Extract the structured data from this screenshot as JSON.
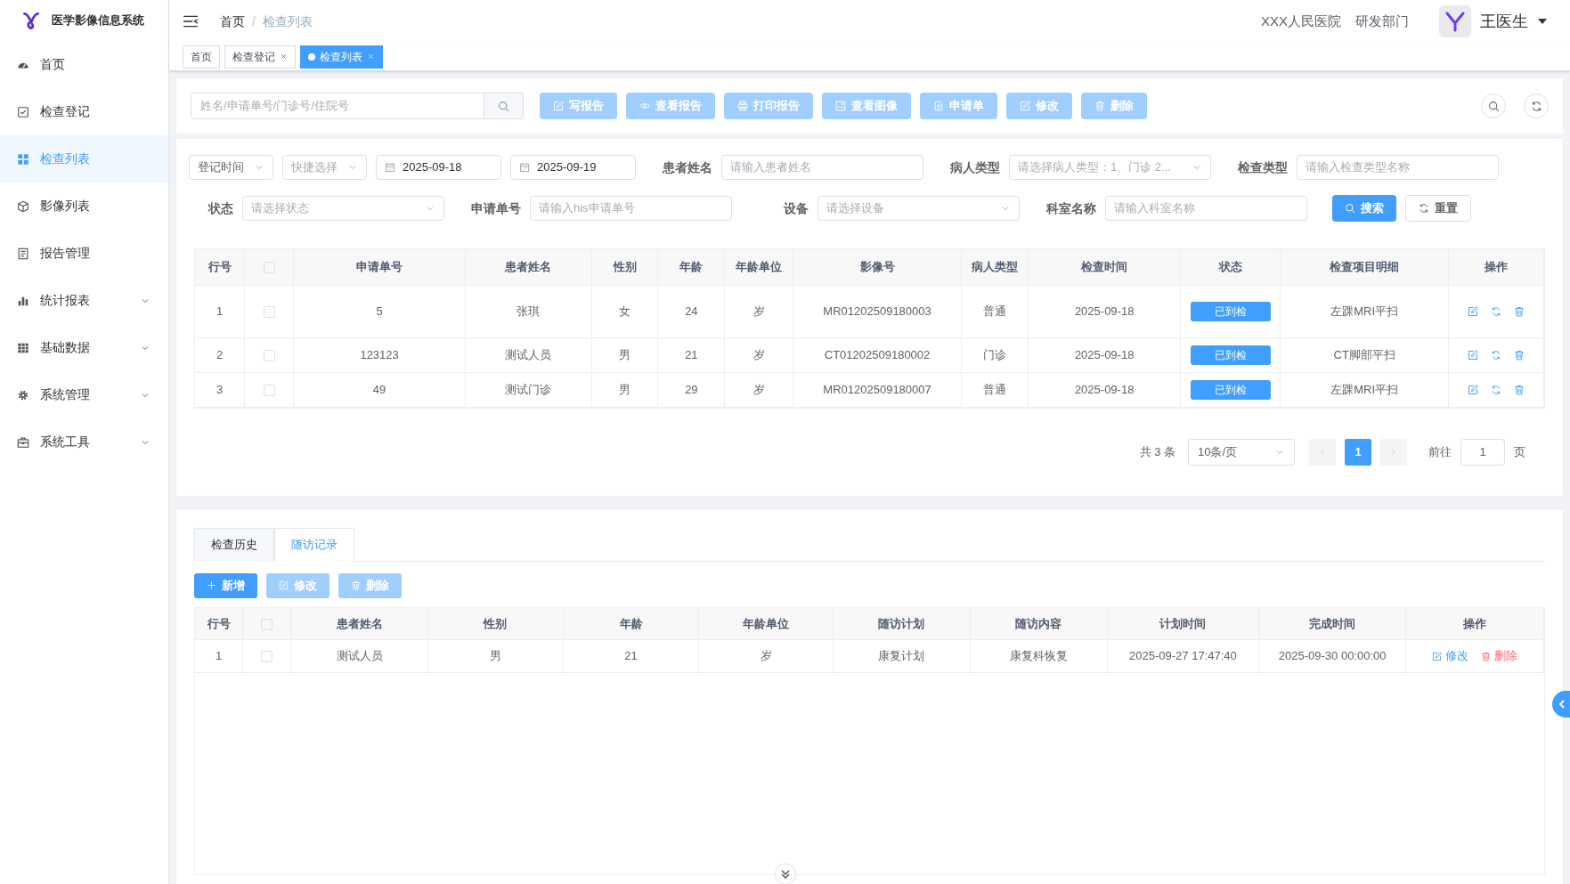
{
  "sidebar": {
    "title": "医学影像信息系统",
    "items": [
      {
        "label": "首页",
        "selected": false,
        "expandable": false
      },
      {
        "label": "检查登记",
        "selected": false,
        "expandable": false
      },
      {
        "label": "检查列表",
        "selected": true,
        "expandable": false
      },
      {
        "label": "影像列表",
        "selected": false,
        "expandable": false
      },
      {
        "label": "报告管理",
        "selected": false,
        "expandable": false
      },
      {
        "label": "统计报表",
        "selected": false,
        "expandable": true
      },
      {
        "label": "基础数据",
        "selected": false,
        "expandable": true
      },
      {
        "label": "系统管理",
        "selected": false,
        "expandable": true
      },
      {
        "label": "系统工具",
        "selected": false,
        "expandable": true
      }
    ]
  },
  "header": {
    "breadcrumb": [
      "首页",
      "检查列表"
    ],
    "breadcrumb_separator": "/",
    "hospital": "XXX人民医院",
    "department": "研发部门",
    "user": "王医生"
  },
  "tags": [
    {
      "label": "首页",
      "selected": false,
      "closable": false
    },
    {
      "label": "检查登记",
      "selected": false,
      "closable": true
    },
    {
      "label": "检查列表",
      "selected": true,
      "closable": true
    }
  ],
  "toolbar": {
    "search_placeholder": "姓名/申请单号/门诊号/住院号",
    "buttons": [
      {
        "label": "写报告",
        "disabled": true
      },
      {
        "label": "查看报告",
        "disabled": true
      },
      {
        "label": "打印报告",
        "disabled": true
      },
      {
        "label": "查看图像",
        "disabled": true
      },
      {
        "label": "申请单",
        "disabled": true
      },
      {
        "label": "修改",
        "disabled": true
      },
      {
        "label": "删除",
        "disabled": true
      }
    ]
  },
  "filters": [
    [
      {
        "kind": "select",
        "value": "登记时间"
      },
      {
        "kind": "select",
        "placeholder": "快捷选择"
      },
      {
        "kind": "date",
        "value": "2025-09-18"
      },
      {
        "kind": "date",
        "value": "2025-09-19"
      },
      {
        "kind": "field",
        "label": "患者姓名",
        "placeholder": "请输入患者姓名"
      },
      {
        "kind": "select",
        "label": "病人类型",
        "placeholder": "请选择病人类型：1、门诊 2..."
      },
      {
        "kind": "field",
        "label": "检查类型",
        "placeholder": "请输入检查类型名称"
      }
    ],
    [
      {
        "kind": "select",
        "label": "状态",
        "placeholder": "请选择状态"
      },
      {
        "kind": "field",
        "label": "申请单号",
        "placeholder": "请输入his申请单号"
      },
      {
        "kind": "select",
        "label": "设备",
        "placeholder": "请选择设备"
      },
      {
        "kind": "field",
        "label": "科室名称",
        "placeholder": "请输入科室名称"
      },
      {
        "kind": "primary",
        "label": "搜索"
      },
      {
        "kind": "reset",
        "label": "重置"
      }
    ]
  ],
  "table": {
    "columns": [
      {
        "label": "行号",
        "kind": "text"
      },
      {
        "kind": "check",
        "checked": false
      },
      {
        "label": "申请单号",
        "kind": "text"
      },
      {
        "label": "患者姓名",
        "kind": "text"
      },
      {
        "label": "性别",
        "kind": "text"
      },
      {
        "label": "年龄",
        "kind": "text"
      },
      {
        "label": "年龄单位",
        "kind": "text"
      },
      {
        "label": "影像号",
        "kind": "text"
      },
      {
        "label": "病人类型",
        "kind": "text"
      },
      {
        "label": "检查时间",
        "kind": "text"
      },
      {
        "label": "状态",
        "kind": "status"
      },
      {
        "label": "检查项目明细",
        "kind": "text"
      },
      {
        "label": "操作",
        "kind": "actions"
      }
    ],
    "rows": [
      {
        "cells": [
          "1",
          {
            "checked": false
          },
          "5",
          "张琪",
          "女",
          "24",
          "岁",
          "MR01202509180003",
          "普通",
          "2025-09-18",
          "已到检",
          "左踝MRI平扫"
        ]
      },
      {
        "cells": [
          "2",
          {
            "checked": false
          },
          "123123",
          "测试人员",
          "男",
          "21",
          "岁",
          "CT01202509180002",
          "门诊",
          "2025-09-18",
          "已到检",
          "CT脚部平扫"
        ]
      },
      {
        "cells": [
          "3",
          {
            "checked": false
          },
          "49",
          "测试门诊",
          "男",
          "29",
          "岁",
          "MR01202509180007",
          "普通",
          "2025-09-18",
          "已到检",
          "左踝MRI平扫"
        ]
      }
    ]
  },
  "pagination": {
    "total": "共 3 条",
    "page_size": "10条/页",
    "pages": [
      {
        "label": "1",
        "selected": true
      }
    ],
    "goto_label": "前往",
    "goto_value": "1",
    "page_unit": "页"
  },
  "bottom": {
    "tabs": [
      {
        "label": "检查历史",
        "selected": false
      },
      {
        "label": "随访记录",
        "selected": true
      }
    ],
    "buttons": [
      {
        "label": "新增",
        "kind": "add",
        "disabled": false
      },
      {
        "label": "修改",
        "kind": "edit",
        "disabled": true
      },
      {
        "label": "删除",
        "kind": "delete",
        "disabled": true
      }
    ],
    "table": {
      "columns": [
        {
          "label": "行号"
        },
        {
          "kind": "check",
          "checked": false
        },
        {
          "label": "患者姓名"
        },
        {
          "label": "性别"
        },
        {
          "label": "年龄"
        },
        {
          "label": "年龄单位"
        },
        {
          "label": "随访计划"
        },
        {
          "label": "随访内容"
        },
        {
          "label": "计划时间"
        },
        {
          "label": "完成时间"
        },
        {
          "label": "操作"
        }
      ],
      "rows": [
        {
          "cells": [
            "1",
            {
              "checked": false
            },
            "测试人员",
            "男",
            "21",
            "岁",
            "康复计划",
            "康复科恢复",
            "2025-09-27 17:47:40",
            "2025-09-30 00:00:00"
          ],
          "actions": [
            {
              "label": "修改",
              "kind": "edit"
            },
            {
              "label": "删除",
              "kind": "delete"
            }
          ]
        }
      ]
    }
  }
}
